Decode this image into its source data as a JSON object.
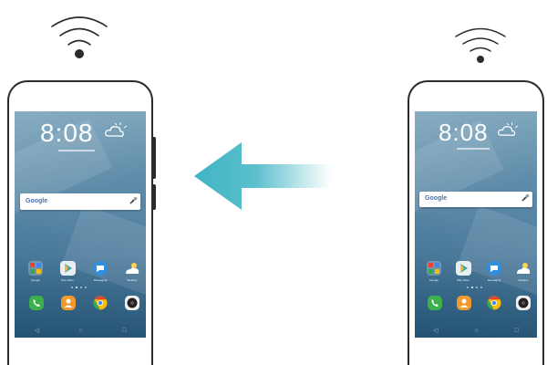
{
  "left_phone": {
    "clock": "8:08",
    "search_logo": "Google",
    "app_labels": [
      "Google",
      "Play Store",
      "Messaging",
      "Weather"
    ],
    "dock_icons": [
      "phone-icon",
      "contacts-icon",
      "chrome-icon",
      "camera-icon"
    ]
  },
  "right_phone": {
    "clock": "8:08",
    "search_logo": "Google",
    "app_labels": [
      "Google",
      "Play Store",
      "Messaging",
      "Weather"
    ],
    "dock_icons": [
      "phone-icon",
      "contacts-icon",
      "chrome-icon",
      "camera-icon"
    ]
  },
  "transfer_direction": "right-to-left",
  "colors": {
    "arrow": "#3fb4c4",
    "wifi": "#2b2b2b",
    "phone_outline": "#2b2b2b",
    "phone_app": "#3cb04a",
    "contacts_app": "#f09a2e",
    "messaging_app": "#2f8fe0"
  }
}
